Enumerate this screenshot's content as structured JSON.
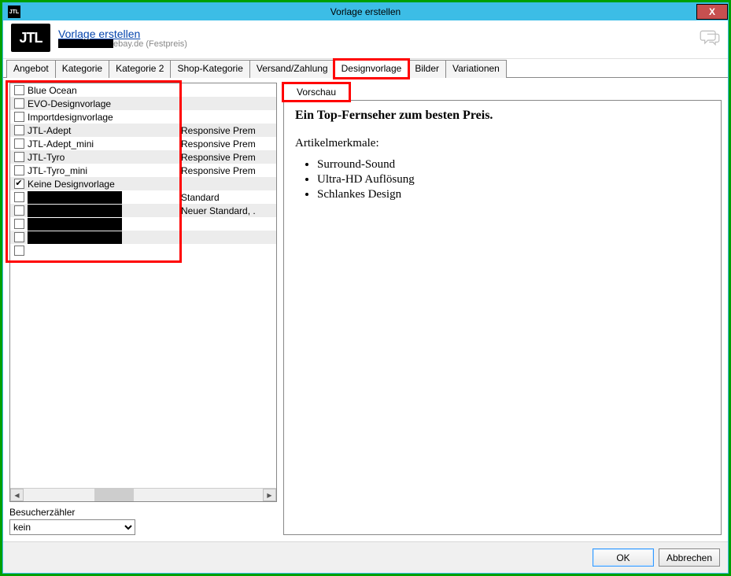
{
  "window": {
    "title": "Vorlage erstellen",
    "close": "X",
    "icon_text": "JTL"
  },
  "header": {
    "logo": "JTL",
    "title": "Vorlage erstellen",
    "subtitle_suffix": "ebay.de (Festpreis)"
  },
  "tabs": [
    {
      "label": "Angebot",
      "active": false
    },
    {
      "label": "Kategorie",
      "active": false
    },
    {
      "label": "Kategorie 2",
      "active": false
    },
    {
      "label": "Shop-Kategorie",
      "active": false
    },
    {
      "label": "Versand/Zahlung",
      "active": false
    },
    {
      "label": "Designvorlage",
      "active": true,
      "highlight": true
    },
    {
      "label": "Bilder",
      "active": false
    },
    {
      "label": "Variationen",
      "active": false
    }
  ],
  "templates": [
    {
      "name": "Blue Ocean",
      "desc": "",
      "checked": false,
      "redacted": false
    },
    {
      "name": "EVO-Designvorlage",
      "desc": "",
      "checked": false,
      "redacted": false
    },
    {
      "name": "Importdesignvorlage",
      "desc": "",
      "checked": false,
      "redacted": false
    },
    {
      "name": "JTL-Adept",
      "desc": "Responsive Prem",
      "checked": false,
      "redacted": false
    },
    {
      "name": "JTL-Adept_mini",
      "desc": "Responsive Prem",
      "checked": false,
      "redacted": false
    },
    {
      "name": "JTL-Tyro",
      "desc": "Responsive Prem",
      "checked": false,
      "redacted": false
    },
    {
      "name": "JTL-Tyro_mini",
      "desc": "Responsive Prem",
      "checked": false,
      "redacted": false
    },
    {
      "name": "Keine Designvorlage",
      "desc": "",
      "checked": true,
      "redacted": false
    },
    {
      "name": "",
      "desc": "Standard",
      "checked": false,
      "redacted": true
    },
    {
      "name": "",
      "desc": "Neuer Standard, .",
      "checked": false,
      "redacted": true
    },
    {
      "name": "",
      "desc": "",
      "checked": false,
      "redacted": true
    },
    {
      "name": "",
      "desc": "",
      "checked": false,
      "redacted": true
    },
    {
      "name": "",
      "desc": "",
      "checked": false,
      "redacted": false
    }
  ],
  "counter": {
    "label": "Besucherzähler",
    "value": "kein"
  },
  "preview": {
    "tab_label": "Vorschau",
    "headline": "Ein Top-Fernseher zum besten Preis.",
    "features_label": "Artikelmerkmale:",
    "features": [
      "Surround-Sound",
      "Ultra-HD Auflösung",
      "Schlankes Design"
    ]
  },
  "footer": {
    "ok": "OK",
    "cancel": "Abbrechen"
  }
}
